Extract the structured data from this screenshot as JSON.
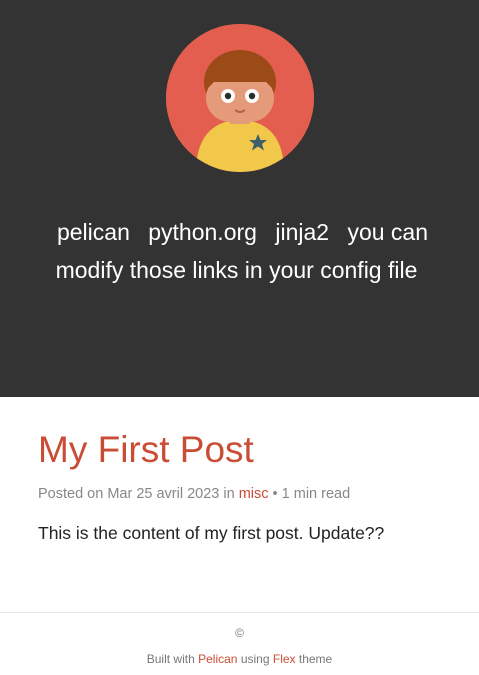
{
  "sidebar": {
    "avatar_icon": "user-avatar-illustration",
    "links": [
      {
        "label": "pelican"
      },
      {
        "label": "python.org"
      },
      {
        "label": "jinja2"
      },
      {
        "label": "you can modify those links in your config file"
      }
    ]
  },
  "post": {
    "title": "My First Post",
    "meta_prefix": "Posted on Mar 25 avril 2023 in",
    "category": "misc",
    "meta_suffix": "• 1 min read",
    "content": "This is the content of my first post. Update??"
  },
  "footer": {
    "copyright": "©",
    "built_with_prefix": "Built with",
    "pelican_link": "Pelican",
    "using_text": "using",
    "flex_link": "Flex",
    "theme_text": "theme"
  },
  "colors": {
    "sidebar_bg": "#333333",
    "accent": "#c94c35",
    "avatar_bg": "#e35e4e",
    "avatar_shirt": "#f2c84b"
  }
}
